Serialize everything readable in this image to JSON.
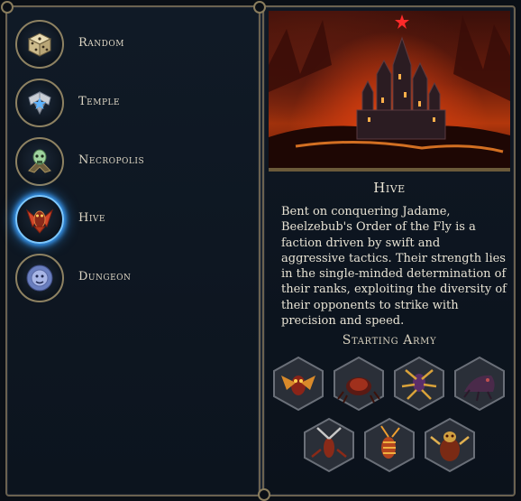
{
  "factions": [
    {
      "label": "Random",
      "icon": "dice-icon"
    },
    {
      "label": "Temple",
      "icon": "temple-wings-icon"
    },
    {
      "label": "Necropolis",
      "icon": "necropolis-skull-icon"
    },
    {
      "label": "Hive",
      "icon": "hive-insect-icon"
    },
    {
      "label": "Dungeon",
      "icon": "dungeon-lion-icon"
    }
  ],
  "selected_faction": "Hive",
  "details": {
    "title": "Hive",
    "description": "Bent on conquering Jadame, Beelzebub's Order of the Fly is a faction driven by swift and aggressive tactics. Their strength lies in the single-minded determination of their ranks, exploiting the diversity of their opponents to strike with precision and speed.",
    "army_heading": "Starting Army"
  },
  "starting_army": [
    {
      "icon": "fly-unit-icon"
    },
    {
      "icon": "beetle-unit-icon"
    },
    {
      "icon": "spider-unit-icon"
    },
    {
      "icon": "crawler-unit-icon"
    },
    {
      "icon": "mantis-unit-icon"
    },
    {
      "icon": "wasp-unit-icon"
    },
    {
      "icon": "queen-unit-icon"
    }
  ],
  "colors": {
    "frame_gold": "#8e8262",
    "selected_glow": "#3aa0ff",
    "fire": "#c93a0e"
  }
}
